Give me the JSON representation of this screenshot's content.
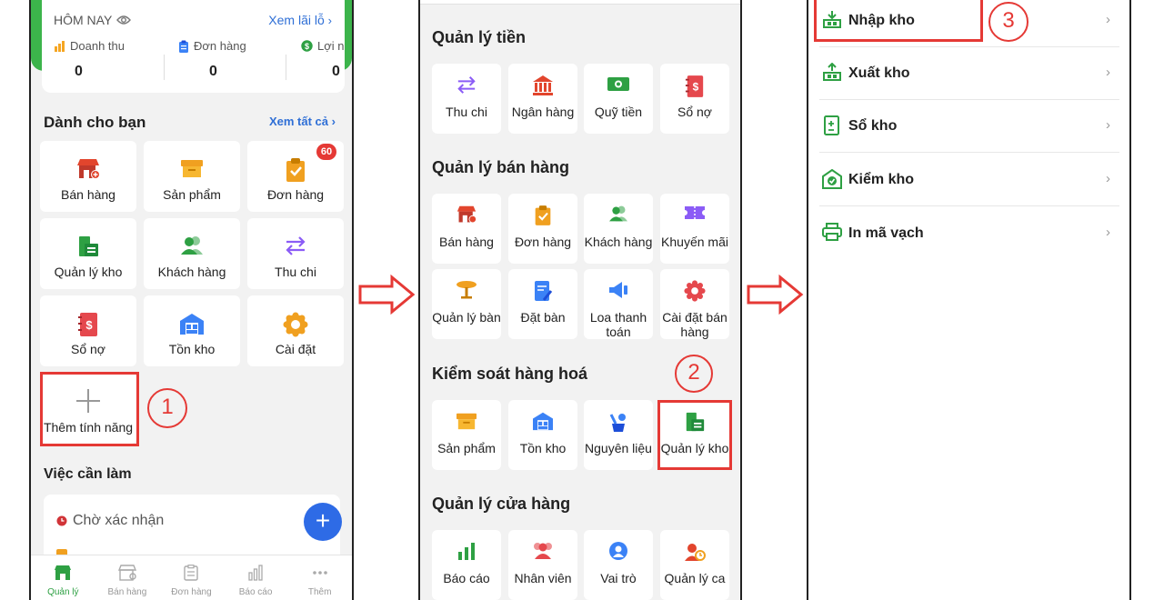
{
  "phone1": {
    "today": {
      "title": "HÔM NAY",
      "link": "Xem lãi lỗ"
    },
    "stats": [
      {
        "label": "Doanh thu",
        "value": "0",
        "icon": "bar-chart-icon"
      },
      {
        "label": "Đơn hàng",
        "value": "0",
        "icon": "clipboard-icon"
      },
      {
        "label": "Lợi n",
        "value": "0",
        "icon": "dollar-coin-icon"
      }
    ],
    "for_you": {
      "title": "Dành cho bạn",
      "see_all": "Xem tất cả"
    },
    "tiles": [
      {
        "label": "Bán hàng",
        "icon": "store-icon"
      },
      {
        "label": "Sản phẩm",
        "icon": "product-box-icon"
      },
      {
        "label": "Đơn hàng",
        "icon": "order-clipboard-icon",
        "badge": "60"
      },
      {
        "label": "Quản lý kho",
        "icon": "warehouse-doc-icon"
      },
      {
        "label": "Khách hàng",
        "icon": "customers-icon"
      },
      {
        "label": "Thu chi",
        "icon": "transfer-arrows-icon"
      },
      {
        "label": "Sổ nợ",
        "icon": "debt-book-icon"
      },
      {
        "label": "Tồn kho",
        "icon": "inventory-icon"
      },
      {
        "label": "Cài đặt",
        "icon": "settings-gear-icon"
      }
    ],
    "add_feature": "Thêm tính năng",
    "step1": "1",
    "todo": {
      "title": "Việc cần làm",
      "pending": "Chờ xác nhận"
    },
    "nav": [
      {
        "label": "Quản lý",
        "icon": "store-nav-icon",
        "active": true
      },
      {
        "label": "Bán hàng",
        "icon": "sell-nav-icon"
      },
      {
        "label": "Đơn hàng",
        "icon": "orders-nav-icon"
      },
      {
        "label": "Báo cáo",
        "icon": "report-nav-icon"
      },
      {
        "label": "Thêm",
        "icon": "more-nav-icon"
      }
    ]
  },
  "phone2": {
    "sections": [
      {
        "title": "Quản lý tiền",
        "items": [
          {
            "label": "Thu chi",
            "icon": "transfer-arrows-icon"
          },
          {
            "label": "Ngân hàng",
            "icon": "bank-icon"
          },
          {
            "label": "Quỹ tiền",
            "icon": "cash-icon"
          },
          {
            "label": "Sổ nợ",
            "icon": "debt-book-icon"
          }
        ]
      },
      {
        "title": "Quản lý bán hàng",
        "items": [
          {
            "label": "Bán hàng",
            "icon": "store-icon"
          },
          {
            "label": "Đơn hàng",
            "icon": "order-clipboard-icon"
          },
          {
            "label": "Khách hàng",
            "icon": "customers-icon"
          },
          {
            "label": "Khuyến mãi",
            "icon": "promo-ticket-icon"
          },
          {
            "label": "Quản lý bàn",
            "icon": "table-icon"
          },
          {
            "label": "Đặt bàn",
            "icon": "booking-icon"
          },
          {
            "label": "Loa thanh toán",
            "icon": "speaker-icon"
          },
          {
            "label": "Cài đặt bán hàng",
            "icon": "settings-flower-icon"
          }
        ]
      },
      {
        "title": "Kiểm soát hàng hoá",
        "items": [
          {
            "label": "Sản phẩm",
            "icon": "product-box-icon"
          },
          {
            "label": "Tồn kho",
            "icon": "inventory-icon"
          },
          {
            "label": "Nguyên liệu",
            "icon": "ingredients-icon"
          },
          {
            "label": "Quản lý kho",
            "icon": "warehouse-doc-icon"
          }
        ]
      },
      {
        "title": "Quản lý cửa hàng",
        "items": [
          {
            "label": "Báo cáo",
            "icon": "report-chart-icon"
          },
          {
            "label": "Nhân viên",
            "icon": "staff-icon"
          },
          {
            "label": "Vai trò",
            "icon": "role-badge-icon"
          },
          {
            "label": "Quản lý ca",
            "icon": "shift-icon"
          }
        ]
      }
    ],
    "step2": "2"
  },
  "phone3": {
    "menu": [
      {
        "label": "Nhập kho",
        "icon": "stock-in-icon"
      },
      {
        "label": "Xuất kho",
        "icon": "stock-out-icon"
      },
      {
        "label": "Sổ kho",
        "icon": "stock-book-icon"
      },
      {
        "label": "Kiểm kho",
        "icon": "stock-check-icon"
      },
      {
        "label": "In mã vạch",
        "icon": "printer-icon"
      }
    ],
    "step3": "3"
  },
  "colors": {
    "accent_green": "#3cb44b",
    "link_blue": "#2f6fd6",
    "highlight_red": "#e53935"
  }
}
